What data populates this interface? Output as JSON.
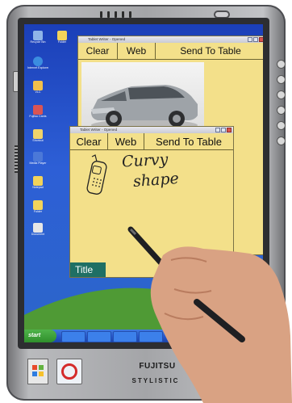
{
  "device": {
    "brand": "FUJITSU",
    "model": "STYLISTIC"
  },
  "back_window": {
    "title": "Tablet Writer - Opened",
    "tools": {
      "clear": "Clear",
      "web": "Web",
      "send": "Send To Table"
    }
  },
  "front_window": {
    "title": "Tablet Writer - Opened",
    "tools": {
      "clear": "Clear",
      "web": "Web",
      "send": "Send To Table"
    },
    "handwriting": [
      "Curvy",
      "shape"
    ],
    "title_label": "Title"
  },
  "taskbar": {
    "start_label": "start",
    "clock": ""
  },
  "desktop_icons": [
    {
      "label": "Recycle Bin",
      "color": "#8fb4e8"
    },
    {
      "label": "Internet Explorer",
      "color": "#3b8de0"
    },
    {
      "label": "VLC",
      "color": "#f1c04a"
    },
    {
      "label": "Fujitsu Cards",
      "color": "#d95454"
    },
    {
      "label": "Shortcut",
      "color": "#f0d36a"
    },
    {
      "label": "Media Player",
      "color": "#4b78d8"
    },
    {
      "label": "Notepad",
      "color": "#f2d35a"
    },
    {
      "label": "Folder",
      "color": "#f2d35a"
    },
    {
      "label": "Document",
      "color": "#e6e6e6"
    },
    {
      "label": "Folder",
      "color": "#f2d35a"
    }
  ],
  "colors": {
    "app_yellow": "#f3e08a",
    "title_tab": "#1f6f64"
  }
}
